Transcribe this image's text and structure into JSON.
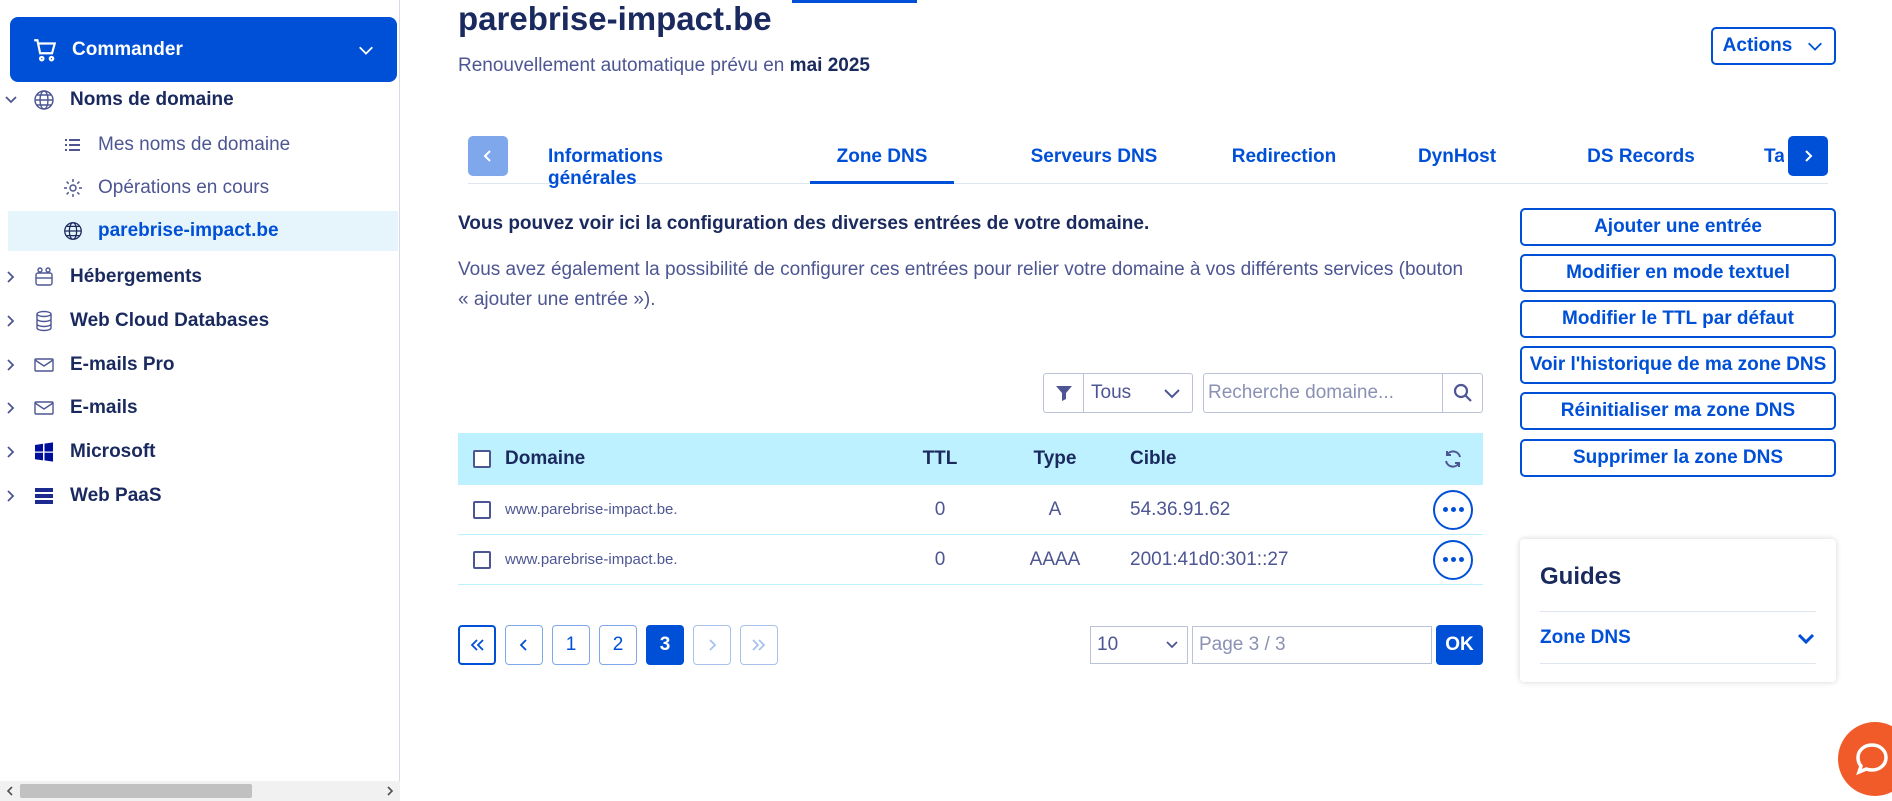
{
  "sidebar": {
    "order_label": "Commander",
    "nav": [
      {
        "label": "Noms de domaine",
        "icon": "globe-icon"
      },
      {
        "label": "Hébergements",
        "icon": "hosting-icon"
      },
      {
        "label": "Web Cloud Databases",
        "icon": "database-icon"
      },
      {
        "label": "E-mails Pro",
        "icon": "mail-icon"
      },
      {
        "label": "E-mails",
        "icon": "mail-icon"
      },
      {
        "label": "Microsoft",
        "icon": "windows-icon"
      },
      {
        "label": "Web PaaS",
        "icon": "paas-icon"
      }
    ],
    "sub": [
      {
        "label": "Mes noms de domaine",
        "icon": "list-icon"
      },
      {
        "label": "Opérations en cours",
        "icon": "gear-icon"
      },
      {
        "label": "parebrise-impact.be",
        "icon": "globe-icon"
      }
    ]
  },
  "header": {
    "title": "parebrise-impact.be",
    "renewal_prefix": "Renouvellement automatique prévu en",
    "renewal_date": "mai 2025",
    "actions_label": "Actions"
  },
  "tabs": [
    "Informations générales",
    "Zone DNS",
    "Serveurs DNS",
    "Redirection",
    "DynHost",
    "DS Records",
    "Ta"
  ],
  "active_tab": "Zone DNS",
  "info": {
    "bold": "Vous pouvez voir ici la configuration des diverses entrées de votre domaine.",
    "text": "Vous avez également la possibilité de configurer ces entrées pour relier votre domaine à vos différents services (bouton « ajouter une entrée »)."
  },
  "filter": {
    "value": "Tous",
    "search_placeholder": "Recherche domaine..."
  },
  "table": {
    "headers": {
      "domain": "Domaine",
      "ttl": "TTL",
      "type": "Type",
      "target": "Cible"
    },
    "rows": [
      {
        "domain": "www.parebrise-impact.be.",
        "ttl": "0",
        "type": "A",
        "target": "54.36.91.62"
      },
      {
        "domain": "www.parebrise-impact.be.",
        "ttl": "0",
        "type": "AAAA",
        "target": "2001:41d0:301::27"
      }
    ]
  },
  "pagination": {
    "pages": [
      "1",
      "2",
      "3"
    ],
    "current": "3",
    "page_size": "10",
    "page_placeholder": "Page 3 / 3",
    "ok_label": "OK"
  },
  "actions": [
    "Ajouter une entrée",
    "Modifier en mode textuel",
    "Modifier le TTL par défaut",
    "Voir l'historique de ma zone DNS",
    "Réinitialiser ma zone DNS",
    "Supprimer la zone DNS"
  ],
  "guides": {
    "title": "Guides",
    "item": "Zone DNS"
  },
  "colors": {
    "primary": "#0050d7",
    "header_bg": "#bef1ff",
    "chat": "#f15b2a"
  }
}
